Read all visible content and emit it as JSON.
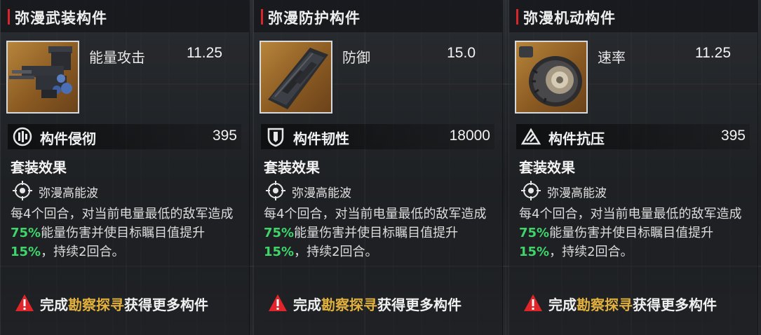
{
  "panels": [
    {
      "title": "弥漫武装构件",
      "stat": {
        "label": "能量攻击",
        "value": "11.25"
      },
      "attr": {
        "label": "构件侵彻",
        "value": "395"
      },
      "set_title": "套装效果",
      "set_name": "弥漫高能波",
      "desc": {
        "p1": "每4个回合，对当前电量最低的敌军造成",
        "v1": "75%",
        "p2": "能量伤害并使目标瞩目值提升",
        "v2": "15%",
        "p3": "，持续2回合。"
      },
      "hint": {
        "pre": "完成",
        "highlight": "勘察探寻",
        "post": "获得更多构件"
      }
    },
    {
      "title": "弥漫防护构件",
      "stat": {
        "label": "防御",
        "value": "15.0"
      },
      "attr": {
        "label": "构件韧性",
        "value": "18000"
      },
      "set_title": "套装效果",
      "set_name": "弥漫高能波",
      "desc": {
        "p1": "每4个回合，对当前电量最低的敌军造成",
        "v1": "75%",
        "p2": "能量伤害并使目标瞩目值提升",
        "v2": "15%",
        "p3": "，持续2回合。"
      },
      "hint": {
        "pre": "完成",
        "highlight": "勘察探寻",
        "post": "获得更多构件"
      }
    },
    {
      "title": "弥漫机动构件",
      "stat": {
        "label": "速率",
        "value": "11.25"
      },
      "attr": {
        "label": "构件抗压",
        "value": "395"
      },
      "set_title": "套装效果",
      "set_name": "弥漫高能波",
      "desc": {
        "p1": "每4个回合，对当前电量最低的敌军造成",
        "v1": "75%",
        "p2": "能量伤害并使目标瞩目值提升",
        "v2": "15%",
        "p3": "，持续2回合。"
      },
      "hint": {
        "pre": "完成",
        "highlight": "勘察探寻",
        "post": "获得更多构件"
      }
    }
  ],
  "icons": {
    "weapon": "gun-part-icon",
    "armor": "armor-plate-icon",
    "mobility": "wheel-part-icon",
    "penetration": "penetration-icon",
    "toughness": "shield-icon",
    "pressure": "pressure-triangle-icon",
    "set": "target-crosshair-icon",
    "warning": "warning-icon"
  },
  "colors": {
    "accent_red": "#d8262a",
    "highlight_green": "#3fd56b",
    "highlight_gold": "#e2b03c"
  }
}
